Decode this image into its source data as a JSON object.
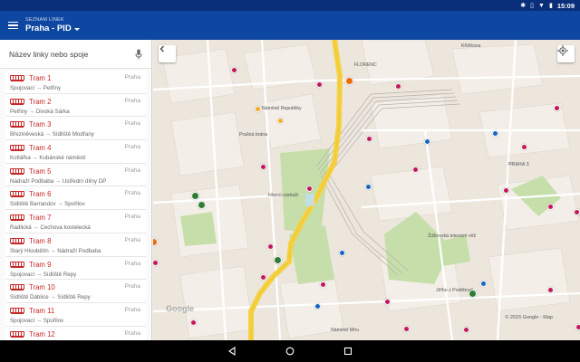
{
  "status_bar": {
    "time": "15:09"
  },
  "app_bar": {
    "subtitle": "SEZNAM LINEK",
    "city": "Praha - PID"
  },
  "search": {
    "placeholder": "Název linky nebo spoje"
  },
  "lines": [
    {
      "name": "Tram 1",
      "city": "Praha",
      "route": "Spojovací → Petřiny"
    },
    {
      "name": "Tram 2",
      "city": "Praha",
      "route": "Petřiny → Divoká Šárka"
    },
    {
      "name": "Tram 3",
      "city": "Praha",
      "route": "Březiněveská → Sídliště Modřany"
    },
    {
      "name": "Tram 4",
      "city": "Praha",
      "route": "Kotlářka → Kubánské náměstí"
    },
    {
      "name": "Tram 5",
      "city": "Praha",
      "route": "Nádraží Podbaba → Ústřední dílny DP"
    },
    {
      "name": "Tram 6",
      "city": "Praha",
      "route": "Sídliště Barrandov → Spořilov"
    },
    {
      "name": "Tram 7",
      "city": "Praha",
      "route": "Radlická → Čechova kostelecká"
    },
    {
      "name": "Tram 8",
      "city": "Praha",
      "route": "Starý Hloubětín → Nádraží Podbaba"
    },
    {
      "name": "Tram 9",
      "city": "Praha",
      "route": "Spojovací → Sídliště Řepy"
    },
    {
      "name": "Tram 10",
      "city": "Praha",
      "route": "Sídliště Ďáblice → Sídliště Řepy"
    },
    {
      "name": "Tram 11",
      "city": "Praha",
      "route": "Spojovací → Spořilov"
    },
    {
      "name": "Tram 12",
      "city": "Praha",
      "route": ""
    }
  ],
  "map": {
    "labels": {
      "krizikova": "Křižíkova",
      "florenc": "FLORENC",
      "namesti_republiky": "Náměstí Republiky",
      "prasna_brana": "Prašná brána",
      "hlavni_nadrazi": "Hlavní nádraží",
      "praha3": "PRAHA 3",
      "zizkov_tower": "Žižkovská televizní věž",
      "jiriho": "Jiřího z Poděbrad",
      "namesti_miru": "Náměstí Míru",
      "copyright": "© 2015 Google - Map"
    },
    "colors": {
      "tram": "#c2185b",
      "bus": "#1565c0",
      "metro_a": "#2e7d32",
      "metro_b": "#f9a825",
      "orange": "#ef6c00",
      "rail": "#5d7a2b"
    }
  }
}
